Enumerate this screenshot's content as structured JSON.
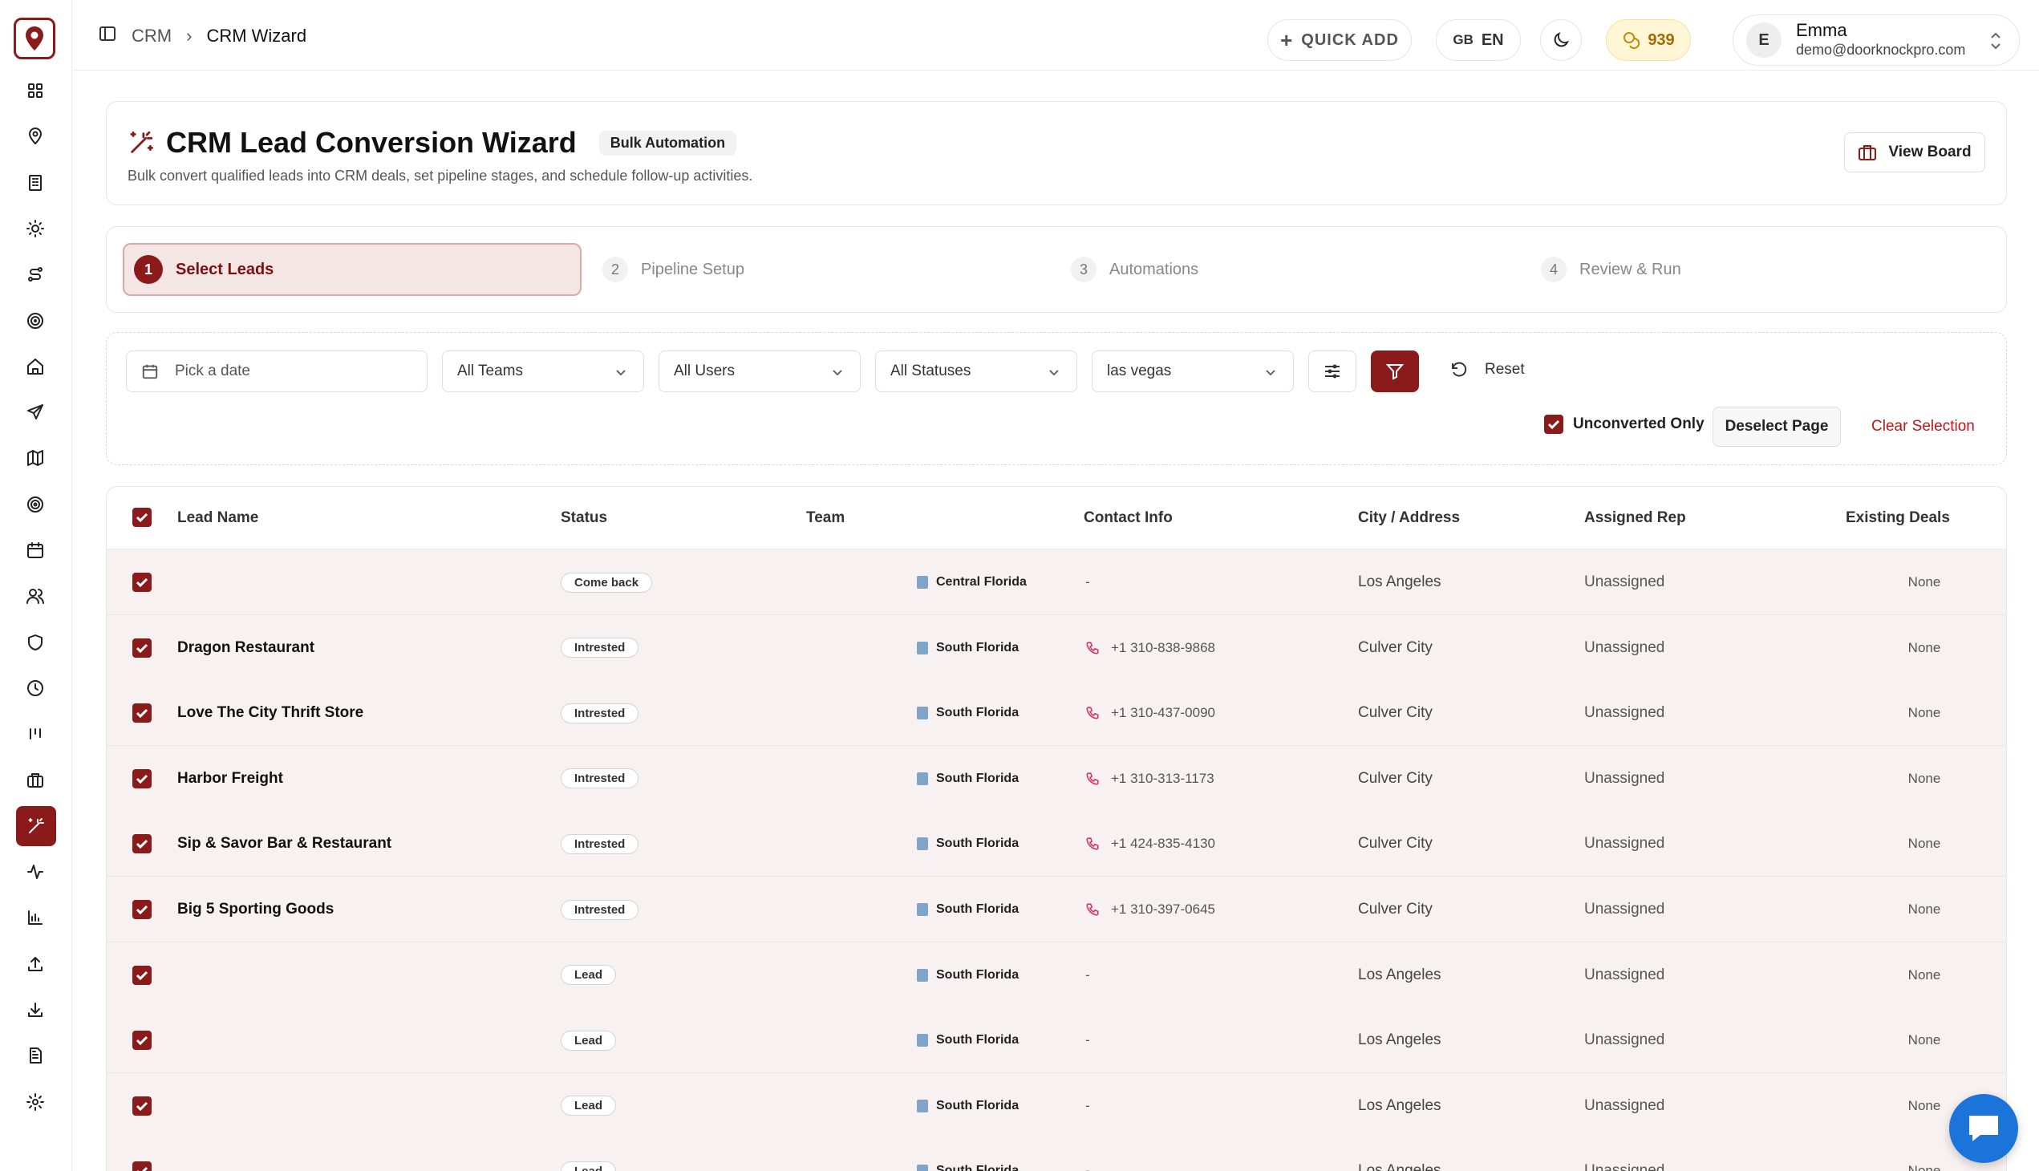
{
  "header": {
    "breadcrumb": [
      "CRM",
      "CRM Wizard"
    ],
    "quick_add": "QUICK ADD",
    "lang_flag": "GB",
    "lang_code": "EN",
    "coins": "939",
    "user": {
      "initial": "E",
      "name": "Emma",
      "email": "demo@doorknockpro.com"
    }
  },
  "sidebar": {
    "icons": [
      "grid-icon",
      "map-pin-icon",
      "building-icon",
      "sun-icon",
      "route-icon",
      "target-icon",
      "home-icon",
      "send-icon",
      "map-icon",
      "radar-icon",
      "calendar-icon",
      "users-icon",
      "shield-icon",
      "clock-icon",
      "bars-icon",
      "briefcase-icon",
      "wand-icon",
      "activity-icon",
      "bar-chart-icon",
      "upload-icon",
      "download-icon",
      "document-icon",
      "settings-icon"
    ],
    "active": "wand-icon"
  },
  "page": {
    "title": "CRM Lead Conversion Wizard",
    "badge": "Bulk Automation",
    "subtitle": "Bulk convert qualified leads into CRM deals, set pipeline stages, and schedule follow-up activities.",
    "view_board": "View Board"
  },
  "steps": [
    {
      "num": "1",
      "label": "Select Leads",
      "active": true
    },
    {
      "num": "2",
      "label": "Pipeline Setup",
      "active": false
    },
    {
      "num": "3",
      "label": "Automations",
      "active": false
    },
    {
      "num": "4",
      "label": "Review & Run",
      "active": false
    }
  ],
  "filters": {
    "date_placeholder": "Pick a date",
    "teams": "All Teams",
    "users": "All Users",
    "statuses": "All Statuses",
    "city": "las vegas",
    "reset": "Reset",
    "unconverted_only": "Unconverted Only",
    "deselect_page": "Deselect Page",
    "clear_selection": "Clear Selection"
  },
  "table": {
    "columns": [
      "Lead Name",
      "Status",
      "Team",
      "Contact Info",
      "City / Address",
      "Assigned Rep",
      "Existing Deals"
    ],
    "rows": [
      {
        "name": "",
        "status": "Come back",
        "team": "Central Florida",
        "contact": "-",
        "city": "Los Angeles",
        "rep": "Unassigned",
        "deals": "None"
      },
      {
        "name": "Dragon Restaurant",
        "status": "Intrested",
        "team": "South Florida",
        "contact": "+1 310-838-9868",
        "city": "Culver City",
        "rep": "Unassigned",
        "deals": "None"
      },
      {
        "name": "Love The City Thrift Store",
        "status": "Intrested",
        "team": "South Florida",
        "contact": "+1 310-437-0090",
        "city": "Culver City",
        "rep": "Unassigned",
        "deals": "None"
      },
      {
        "name": "Harbor Freight",
        "status": "Intrested",
        "team": "South Florida",
        "contact": "+1 310-313-1173",
        "city": "Culver City",
        "rep": "Unassigned",
        "deals": "None"
      },
      {
        "name": "Sip & Savor Bar & Restaurant",
        "status": "Intrested",
        "team": "South Florida",
        "contact": "+1 424-835-4130",
        "city": "Culver City",
        "rep": "Unassigned",
        "deals": "None"
      },
      {
        "name": "Big 5 Sporting Goods",
        "status": "Intrested",
        "team": "South Florida",
        "contact": "+1 310-397-0645",
        "city": "Culver City",
        "rep": "Unassigned",
        "deals": "None"
      },
      {
        "name": "",
        "status": "Lead",
        "team": "South Florida",
        "contact": "-",
        "city": "Los Angeles",
        "rep": "Unassigned",
        "deals": "None"
      },
      {
        "name": "",
        "status": "Lead",
        "team": "South Florida",
        "contact": "-",
        "city": "Los Angeles",
        "rep": "Unassigned",
        "deals": "None"
      },
      {
        "name": "",
        "status": "Lead",
        "team": "South Florida",
        "contact": "-",
        "city": "Los Angeles",
        "rep": "Unassigned",
        "deals": "None"
      },
      {
        "name": "",
        "status": "Lead",
        "team": "South Florida",
        "contact": "-",
        "city": "Los Angeles",
        "rep": "Unassigned",
        "deals": "None"
      }
    ]
  },
  "colors": {
    "accent": "#8b1a1a",
    "row_bg": "#f8f1f1",
    "danger": "#c0141a",
    "chat": "#1b74d9"
  }
}
